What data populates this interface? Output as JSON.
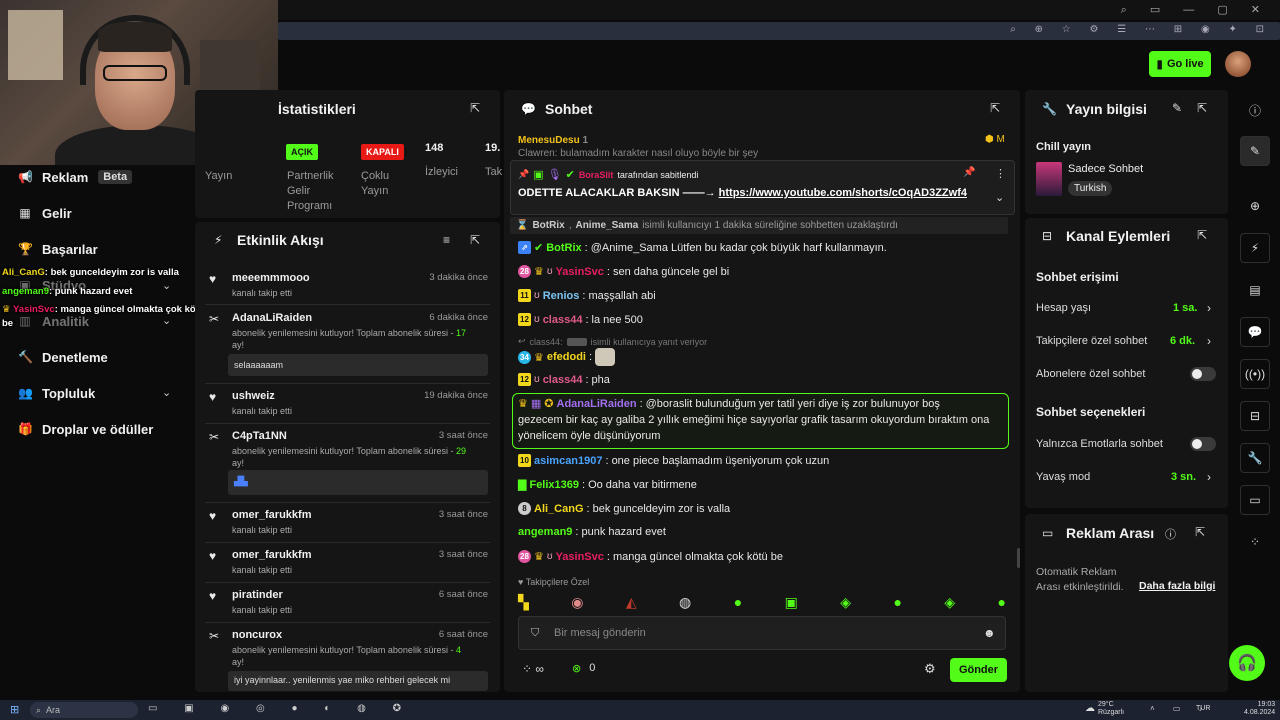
{
  "header": {
    "go_live": "Go live"
  },
  "sidebar": {
    "items": [
      {
        "label": "Reklam",
        "badge": "Beta",
        "icon": "megaphone-icon"
      },
      {
        "label": "Gelir",
        "icon": "bank-icon"
      },
      {
        "label": "Başarılar",
        "icon": "trophy-icon"
      },
      {
        "label": "Stüdyo",
        "icon": "studio-icon"
      },
      {
        "label": "Analitik",
        "icon": "chart-icon"
      },
      {
        "label": "Denetleme",
        "icon": "hammer-icon"
      },
      {
        "label": "Topluluk",
        "icon": "people-icon"
      },
      {
        "label": "Droplar ve ödüller",
        "icon": "gift-icon"
      }
    ]
  },
  "overlay_chat": [
    {
      "user": "Ali_CanG",
      "text": ": bek gunceldeyim zor is valla",
      "color": "#f2d71b"
    },
    {
      "user": "angeman9",
      "text": ": punk hazard evet",
      "color": "#53fc18"
    },
    {
      "user": "YasinSvc",
      "text": ": manga güncel olmakta çok kötü",
      "color": "#e91e63"
    },
    {
      "user": "",
      "text": "be",
      "color": "#ffffff"
    }
  ],
  "stats": {
    "title": "İstatistikleri",
    "yayin": "Yayın",
    "partner_status": "AÇIK",
    "partner_label": "Partnerlik Gelir Programı",
    "multi_status": "KAPALI",
    "multi_label": "Çoklu Yayın",
    "viewers": "148",
    "viewers_label": "İzleyici",
    "followers": "19.",
    "followers_label": "Tak"
  },
  "activity": {
    "title": "Etkinlik Akışı",
    "items": [
      {
        "name": "meeemmmooo",
        "time": "3 dakika önce",
        "sub": "kanalı takip etti"
      },
      {
        "name": "AdanaLiRaiden",
        "time": "6 dakika önce",
        "sub": "abonelik yenilemesini kutluyor! Toplam abonelik süresi - ",
        "months": "17",
        "sub2": "ay!",
        "box": "selaaaaaam"
      },
      {
        "name": "ushweiz",
        "time": "19 dakika önce",
        "sub": "kanalı takip etti"
      },
      {
        "name": "C4pTa1NN",
        "time": "3 saat önce",
        "sub": "abonelik yenilemesini kutluyor! Toplam abonelik süresi - ",
        "months": "29",
        "sub2": "ay!"
      },
      {
        "name": "omer_farukkfm",
        "time": "3 saat önce",
        "sub": "kanalı takip etti"
      },
      {
        "name": "omer_farukkfm",
        "time": "3 saat önce",
        "sub": "kanalı takip etti"
      },
      {
        "name": "piratinder",
        "time": "6 saat önce",
        "sub": "kanalı takip etti"
      },
      {
        "name": "noncurox",
        "time": "6 saat önce",
        "sub": "abonelik yenilemesini kutluyor! Toplam abonelik süresi - ",
        "months": "4",
        "sub2": "ay!",
        "box": "iyi yayinnlaar.. yenilenmis yae miko rehberi gelecek mi"
      }
    ]
  },
  "chat": {
    "title": "Sohbet",
    "top_user": "MenesuDesu",
    "top_count": "1",
    "top_right": "M",
    "behind_text": "Clawren: bulamadım karakter nasıl oluyo böyle bir şey",
    "pinned_by": "BoraSlit",
    "pinned_by_suffix": "tarafından sabitlendi",
    "pinned_text": "ODETTE ALACAKLAR BAKSIN ——→",
    "pinned_link": "https://www.youtube.com/shorts/cOqAD3ZZwf4",
    "timeout_notice": {
      "mod": "BotRix",
      "user": "Anime_Sama",
      "text": "isimli kullanıcıyı 1 dakika süreliğine sohbetten uzaklaştırdı"
    },
    "reply_notice": {
      "user": "class44:",
      "text": "isimli kullanıcıya yanıt veriyor"
    },
    "messages": [
      {
        "user": "BotRix",
        "text": "@Anime_Sama Lütfen bu kadar çok büyük harf kullanmayın.",
        "color": "#53fc18",
        "badges": "bot"
      },
      {
        "user": "YasinSvc",
        "text": "sen daha güncele gel bi",
        "color": "#e91e63",
        "num": "28"
      },
      {
        "user": "Renios",
        "text": "maşşallah abi",
        "color": "#7cc4f0",
        "num": "11"
      },
      {
        "user": "class44",
        "text": "la nee 500",
        "color": "#e05a8c",
        "num": "12"
      },
      {
        "user": "efedodi",
        "text": "",
        "color": "#f2d71b",
        "num": "34"
      },
      {
        "user": "class44",
        "text": "pha",
        "color": "#e05a8c",
        "num": "12"
      },
      {
        "user": "AdanaLiRaiden",
        "text": "@boraslit bulunduğum yer tatil yeri diye iş zor bulunuyor boş",
        "line2": "gezecem bir kaç ay galiba 2 yıllık emeğimi hiçe sayıyorlar grafik tasarım okuyordum bıraktım ona",
        "line3": "yönelicem öyle düşünüyorum",
        "color": "#a36ef0"
      },
      {
        "user": "asimcan1907",
        "text": "one piece başlamadım üşeniyorum çok uzun",
        "color": "#4aa3ff",
        "num": "10"
      },
      {
        "user": "Felix1369",
        "text": "Oo daha var bitirmene",
        "color": "#53fc18"
      },
      {
        "user": "Ali_CanG",
        "text": "bek gunceldeyim zor is valla",
        "color": "#f2d71b",
        "num": "8"
      },
      {
        "user": "angeman9",
        "text": "punk hazard evet",
        "color": "#53fc18"
      },
      {
        "user": "YasinSvc",
        "text": "manga güncel olmakta çok kötü be",
        "color": "#e91e63",
        "num": "28"
      }
    ],
    "followers_only": "Takipçilere Özel",
    "input_placeholder": "Bir mesaj gönderin",
    "points": "0",
    "send": "Gönder"
  },
  "stream_info": {
    "title": "Yayın bilgisi",
    "stream_title": "Chill yayın",
    "category": "Sadece Sohbet",
    "tag": "Turkish"
  },
  "channel_actions": {
    "title": "Kanal Eylemleri",
    "chat_access": "Sohbet erişimi",
    "account_age": "Hesap yaşı",
    "account_age_val": "1 sa.",
    "followers_only": "Takipçilere özel sohbet",
    "followers_only_val": "6 dk.",
    "subs_only": "Abonelere özel sohbet",
    "chat_options": "Sohbet seçenekleri",
    "emotes_only": "Yalnızca Emotlarla sohbet",
    "slow_mode": "Yavaş mod",
    "slow_mode_val": "3 sn."
  },
  "ad_break": {
    "title": "Reklam Arası",
    "desc": "Otomatik Reklam Arası etkinleştirildi.",
    "link": "Daha fazla bilgi"
  },
  "taskbar": {
    "search": "Ara",
    "weather_temp": "29°C",
    "weather_desc": "Rüzgarlı",
    "lang": "TUR",
    "time": "19:03",
    "date": "4.08.2024"
  },
  "colors": {
    "accent": "#53fc18",
    "panel": "#151515",
    "bg": "#0b0b0b"
  }
}
